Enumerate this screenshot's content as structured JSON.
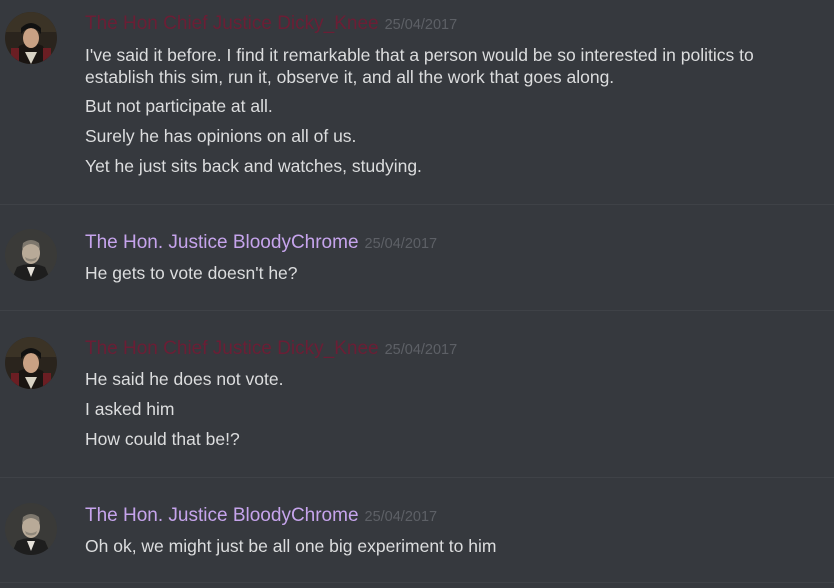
{
  "colors": {
    "background": "#36393e",
    "chief_justice_name": "#6b1e35",
    "bloodychrome_name": "#c6a4ec",
    "timestamp": "#5d6066",
    "message_text": "#dcddde"
  },
  "groups": [
    {
      "author": "The Hon Chief Justice Dicky_Knee",
      "timestamp": "25/04/2017",
      "avatar": "chief-justice-portrait",
      "messages": [
        "I've said it before. I find it remarkable that a person would be so interested in politics to establish this sim, run it, observe it, and all the work that goes along.",
        "But not participate at all.",
        "Surely he has opinions on all of us.",
        "Yet he just sits back and watches, studying."
      ]
    },
    {
      "author": "The Hon. Justice BloodyChrome",
      "timestamp": "25/04/2017",
      "avatar": "bloodychrome-portrait",
      "messages": [
        "He gets to vote doesn't he?"
      ]
    },
    {
      "author": "The Hon Chief Justice Dicky_Knee",
      "timestamp": "25/04/2017",
      "avatar": "chief-justice-portrait",
      "messages": [
        "He said he does not vote.",
        "I asked him",
        "How could that be!?"
      ]
    },
    {
      "author": "The Hon. Justice BloodyChrome",
      "timestamp": "25/04/2017",
      "avatar": "bloodychrome-portrait",
      "messages": [
        "Oh ok, we might just be all one big experiment to him"
      ]
    }
  ]
}
